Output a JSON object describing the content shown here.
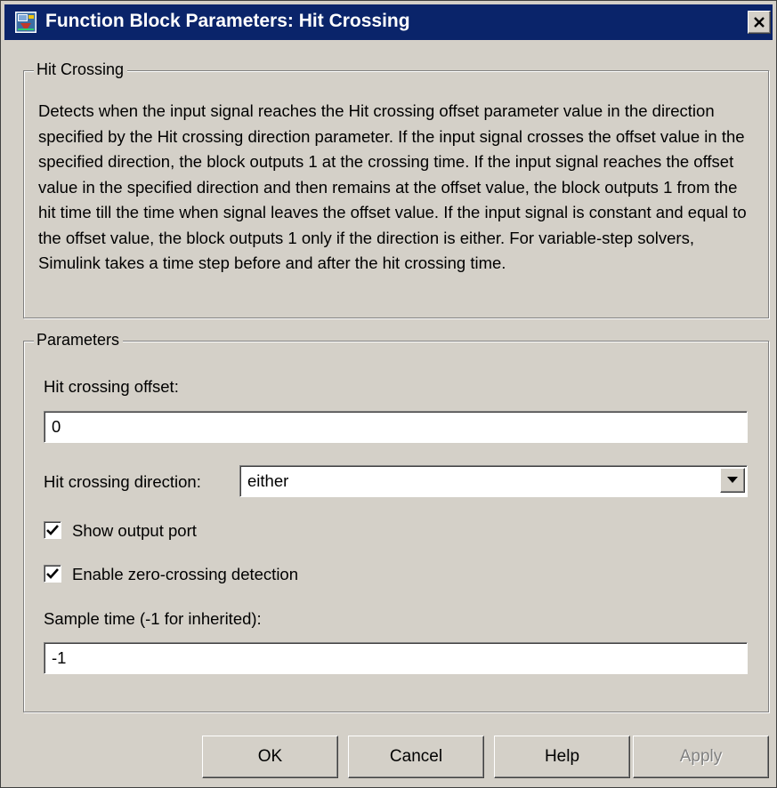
{
  "window": {
    "title": "Function Block Parameters: Hit Crossing",
    "close_symbol": "✕",
    "icon": "simulink-block-icon"
  },
  "description_group": {
    "legend": "Hit Crossing",
    "text": "Detects when the input signal reaches the Hit crossing offset parameter value in the direction specified by the Hit crossing direction parameter. If the input signal crosses the offset value in the specified direction, the block outputs 1 at the crossing time. If the input signal reaches the offset value in the specified direction and then remains at the offset value, the block outputs 1 from the hit time till the time when signal leaves the offset value. If the input signal is constant and equal to the offset value, the block outputs 1 only if the direction is either. For variable-step solvers, Simulink takes a time step before and after the hit crossing time."
  },
  "parameters_group": {
    "legend": "Parameters",
    "offset": {
      "label": "Hit crossing offset:",
      "value": "0"
    },
    "direction": {
      "label": "Hit crossing direction:",
      "value": "either"
    },
    "show_output_port": {
      "label": "Show output port",
      "checked": true
    },
    "zero_crossing": {
      "label": "Enable zero-crossing detection",
      "checked": true
    },
    "sample_time": {
      "label": "Sample time (-1 for inherited):",
      "value": "-1"
    }
  },
  "buttons": {
    "ok": "OK",
    "cancel": "Cancel",
    "help": "Help",
    "apply": "Apply",
    "apply_enabled": false
  },
  "colors": {
    "dialog_background": "#d4d0c8",
    "titlebar": "#0a246a",
    "title_text": "#ffffff",
    "disabled_text": "#808080"
  }
}
